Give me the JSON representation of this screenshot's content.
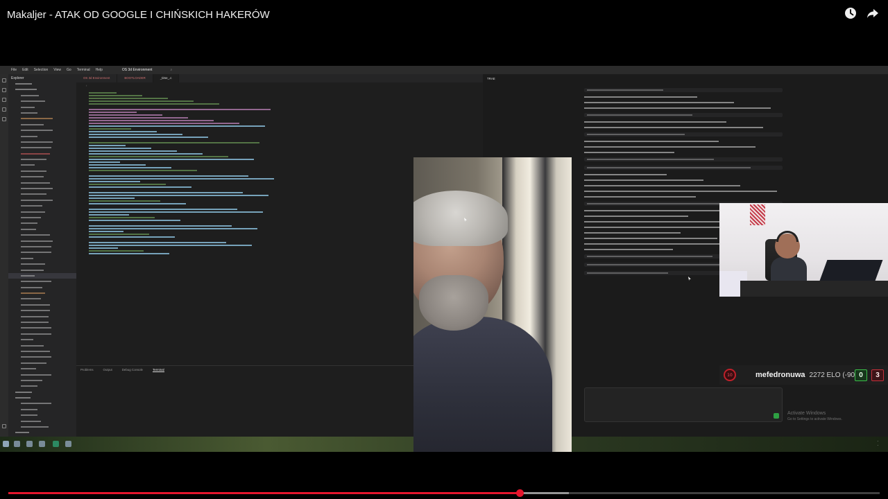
{
  "video": {
    "title": "Makaljer - ATAK OD GOOGLE I CHIŃSKICH HAKERÓW",
    "progress_fraction": 0.587,
    "buffer_fraction": 0.643
  },
  "icons": {
    "watch_later": "clock-icon",
    "share": "share-arrow-icon"
  },
  "ide": {
    "menu": [
      "File",
      "Edit",
      "Selection",
      "View",
      "Go",
      "Terminal",
      "Help"
    ],
    "project_name": "OS 3d Environment",
    "explorer_title": "Explorer",
    "tabs": [
      "OS 3d Environment",
      "BOOTLOADER",
      "_time_.c"
    ],
    "panel_tabs": [
      "Problems",
      "Output",
      "Debug Console",
      "Terminal"
    ],
    "right_pane_title": "TRAE"
  },
  "player": {
    "name": "mefedronuwa",
    "elo": "2272 ELO (-90)",
    "level": "10",
    "wins": "0",
    "losses": "3"
  },
  "windows_watermark": {
    "line1": "Activate Windows",
    "line2": "Go to Settings to activate Windows."
  },
  "colors": {
    "progress": "#e5162d",
    "win": "#3bbf4a",
    "loss": "#c5303a"
  }
}
